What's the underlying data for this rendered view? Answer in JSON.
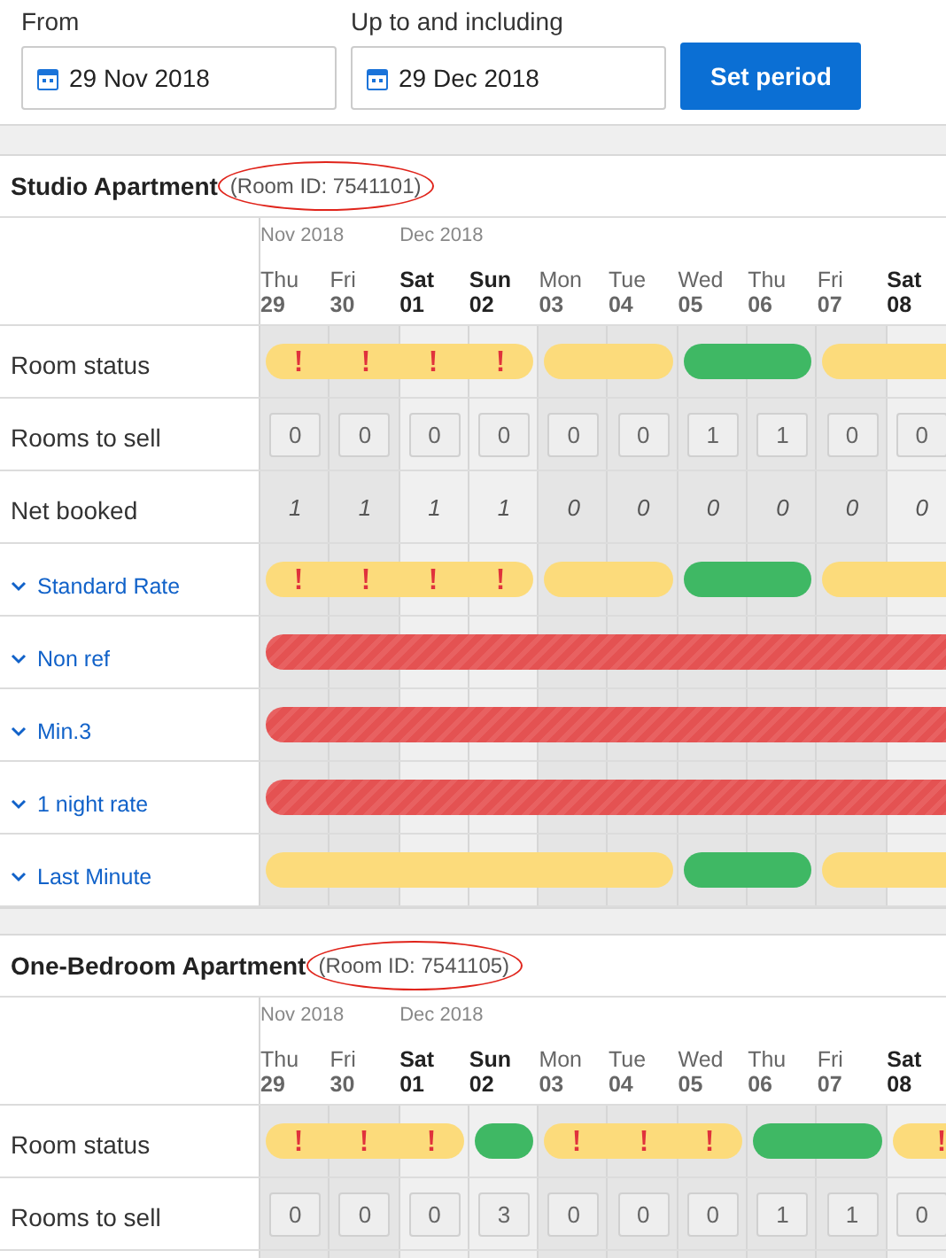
{
  "filters": {
    "from": {
      "label": "From",
      "value": "29 Nov 2018"
    },
    "to": {
      "label": "Up to and including",
      "value": "29 Dec 2018"
    },
    "button": "Set period"
  },
  "rooms": [
    {
      "name": "Studio Apartment",
      "room_id": "(Room ID: 7541101)",
      "days": [
        {
          "month": "Nov 2018",
          "dow": "Thu",
          "date": "29",
          "weekend": false
        },
        {
          "dow": "Fri",
          "date": "30",
          "weekend": false
        },
        {
          "month": "Dec 2018",
          "dow": "Sat",
          "date": "01",
          "weekend": true
        },
        {
          "dow": "Sun",
          "date": "02",
          "weekend": true
        },
        {
          "dow": "Mon",
          "date": "03",
          "weekend": false
        },
        {
          "dow": "Tue",
          "date": "04",
          "weekend": false
        },
        {
          "dow": "Wed",
          "date": "05",
          "weekend": false
        },
        {
          "dow": "Thu",
          "date": "06",
          "weekend": false
        },
        {
          "dow": "Fri",
          "date": "07",
          "weekend": false
        },
        {
          "dow": "Sat",
          "date": "08",
          "weekend": true
        }
      ],
      "rows": [
        {
          "label": "Room status",
          "kind": "status",
          "days": [
            {
              "kind": "alert"
            },
            {
              "kind": "alert"
            },
            {
              "kind": "alert"
            },
            {
              "kind": "alert"
            },
            {
              "kind": "warning"
            },
            {
              "kind": "warning"
            },
            {
              "kind": "ok"
            },
            {
              "kind": "ok"
            },
            {
              "kind": "warning"
            },
            {
              "kind": "warning"
            }
          ]
        },
        {
          "label": "Rooms to sell",
          "kind": "input",
          "values": [
            "0",
            "0",
            "0",
            "0",
            "0",
            "0",
            "1",
            "1",
            "0",
            "0"
          ]
        },
        {
          "label": "Net booked",
          "kind": "number",
          "values": [
            "1",
            "1",
            "1",
            "1",
            "0",
            "0",
            "0",
            "0",
            "0",
            "0"
          ]
        },
        {
          "label": "Standard Rate",
          "kind": "rate",
          "days": [
            {
              "kind": "alert"
            },
            {
              "kind": "alert"
            },
            {
              "kind": "alert"
            },
            {
              "kind": "alert"
            },
            {
              "kind": "warning"
            },
            {
              "kind": "warning"
            },
            {
              "kind": "ok"
            },
            {
              "kind": "ok"
            },
            {
              "kind": "warning"
            },
            {
              "kind": "warning"
            }
          ]
        },
        {
          "label": "Non ref",
          "kind": "rate",
          "days": [
            {
              "kind": "closed"
            },
            {
              "kind": "closed"
            },
            {
              "kind": "closed"
            },
            {
              "kind": "closed"
            },
            {
              "kind": "closed"
            },
            {
              "kind": "closed"
            },
            {
              "kind": "closed"
            },
            {
              "kind": "closed"
            },
            {
              "kind": "closed"
            },
            {
              "kind": "closed"
            }
          ]
        },
        {
          "label": "Min.3",
          "kind": "rate",
          "days": [
            {
              "kind": "closed"
            },
            {
              "kind": "closed"
            },
            {
              "kind": "closed"
            },
            {
              "kind": "closed"
            },
            {
              "kind": "closed"
            },
            {
              "kind": "closed"
            },
            {
              "kind": "closed"
            },
            {
              "kind": "closed"
            },
            {
              "kind": "closed"
            },
            {
              "kind": "closed"
            }
          ]
        },
        {
          "label": "1 night rate",
          "kind": "rate",
          "days": [
            {
              "kind": "closed"
            },
            {
              "kind": "closed"
            },
            {
              "kind": "closed"
            },
            {
              "kind": "closed"
            },
            {
              "kind": "closed"
            },
            {
              "kind": "closed"
            },
            {
              "kind": "closed"
            },
            {
              "kind": "closed"
            },
            {
              "kind": "closed"
            },
            {
              "kind": "closed"
            }
          ]
        },
        {
          "label": "Last Minute",
          "kind": "rate",
          "days": [
            {
              "kind": "warning"
            },
            {
              "kind": "warning"
            },
            {
              "kind": "warning"
            },
            {
              "kind": "warning"
            },
            {
              "kind": "warning"
            },
            {
              "kind": "warning"
            },
            {
              "kind": "ok"
            },
            {
              "kind": "ok"
            },
            {
              "kind": "warning"
            },
            {
              "kind": "warning"
            }
          ]
        }
      ]
    },
    {
      "name": "One-Bedroom Apartment",
      "room_id": "(Room ID: 7541105)",
      "days": [
        {
          "month": "Nov 2018",
          "dow": "Thu",
          "date": "29",
          "weekend": false
        },
        {
          "dow": "Fri",
          "date": "30",
          "weekend": false
        },
        {
          "month": "Dec 2018",
          "dow": "Sat",
          "date": "01",
          "weekend": true
        },
        {
          "dow": "Sun",
          "date": "02",
          "weekend": true
        },
        {
          "dow": "Mon",
          "date": "03",
          "weekend": false
        },
        {
          "dow": "Tue",
          "date": "04",
          "weekend": false
        },
        {
          "dow": "Wed",
          "date": "05",
          "weekend": false
        },
        {
          "dow": "Thu",
          "date": "06",
          "weekend": false
        },
        {
          "dow": "Fri",
          "date": "07",
          "weekend": false
        },
        {
          "dow": "Sat",
          "date": "08",
          "weekend": true
        }
      ],
      "rows": [
        {
          "label": "Room status",
          "kind": "status",
          "days": [
            {
              "kind": "alert"
            },
            {
              "kind": "alert"
            },
            {
              "kind": "alert"
            },
            {
              "kind": "ok"
            },
            {
              "kind": "alert"
            },
            {
              "kind": "alert"
            },
            {
              "kind": "alert"
            },
            {
              "kind": "ok"
            },
            {
              "kind": "ok"
            },
            {
              "kind": "alert"
            }
          ]
        },
        {
          "label": "Rooms to sell",
          "kind": "input",
          "values": [
            "0",
            "0",
            "0",
            "3",
            "0",
            "0",
            "0",
            "1",
            "1",
            "0"
          ]
        }
      ]
    }
  ]
}
